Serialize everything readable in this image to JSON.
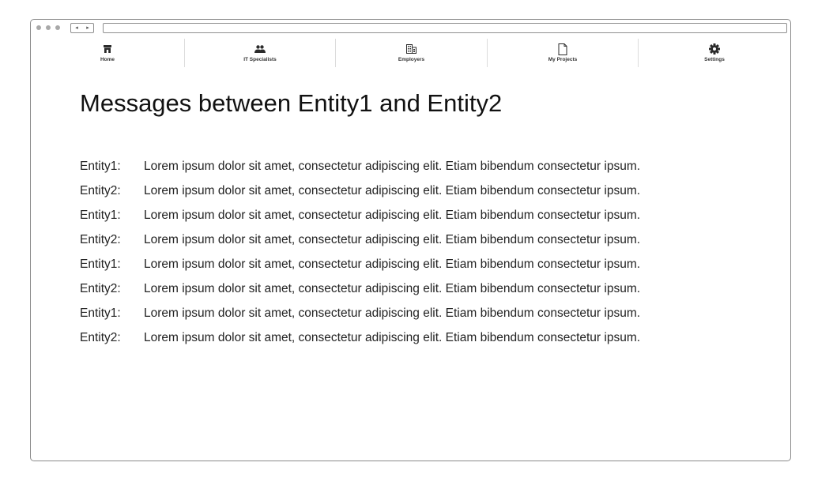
{
  "nav": {
    "back_label": "◂",
    "forward_label": "▸"
  },
  "tabs": [
    {
      "label": "Home",
      "icon": "home-icon"
    },
    {
      "label": "IT Specialists",
      "icon": "people-icon"
    },
    {
      "label": "Employers",
      "icon": "building-icon"
    },
    {
      "label": "My Projects",
      "icon": "document-icon"
    },
    {
      "label": "Settings",
      "icon": "gear-icon"
    }
  ],
  "page": {
    "title": "Messages between Entity1 and Entity2"
  },
  "messages": [
    {
      "sender": "Entity1:",
      "text": "Lorem ipsum dolor sit amet, consectetur adipiscing elit. Etiam bibendum consectetur ipsum."
    },
    {
      "sender": "Entity2:",
      "text": "Lorem ipsum dolor sit amet, consectetur adipiscing elit. Etiam bibendum consectetur ipsum."
    },
    {
      "sender": "Entity1:",
      "text": "Lorem ipsum dolor sit amet, consectetur adipiscing elit. Etiam bibendum consectetur ipsum."
    },
    {
      "sender": "Entity2:",
      "text": "Lorem ipsum dolor sit amet, consectetur adipiscing elit. Etiam bibendum consectetur ipsum."
    },
    {
      "sender": "Entity1:",
      "text": "Lorem ipsum dolor sit amet, consectetur adipiscing elit. Etiam bibendum consectetur ipsum."
    },
    {
      "sender": "Entity2:",
      "text": "Lorem ipsum dolor sit amet, consectetur adipiscing elit. Etiam bibendum consectetur ipsum."
    },
    {
      "sender": "Entity1:",
      "text": "Lorem ipsum dolor sit amet, consectetur adipiscing elit. Etiam bibendum consectetur ipsum."
    },
    {
      "sender": "Entity2:",
      "text": "Lorem ipsum dolor sit amet, consectetur adipiscing elit. Etiam bibendum consectetur ipsum."
    }
  ]
}
